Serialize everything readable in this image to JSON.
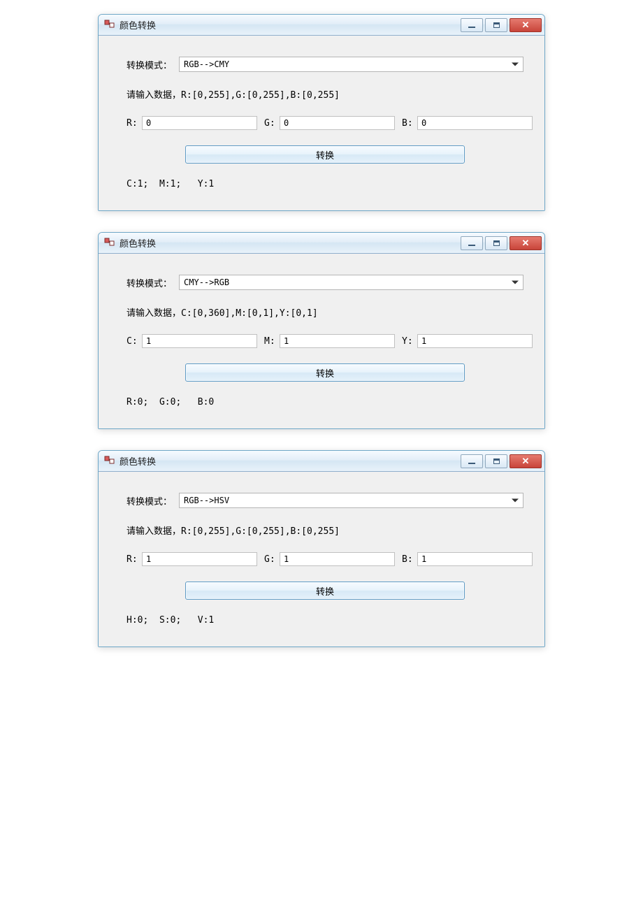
{
  "windows": [
    {
      "title": "颜色转换",
      "mode_label": "转换模式：",
      "mode_value": "RGB-->CMY",
      "hint": "请输入数据，R:[0,255],G:[0,255],B:[0,255]",
      "inputs": [
        {
          "label": "R:",
          "value": "0"
        },
        {
          "label": "G:",
          "value": "0"
        },
        {
          "label": "B:",
          "value": "0"
        }
      ],
      "convert_label": "转换",
      "result": "C:1;  M:1;   Y:1"
    },
    {
      "title": "颜色转换",
      "mode_label": "转换模式：",
      "mode_value": "CMY-->RGB",
      "hint": "请输入数据，C:[0,360],M:[0,1],Y:[0,1]",
      "inputs": [
        {
          "label": "C:",
          "value": "1"
        },
        {
          "label": "M:",
          "value": "1"
        },
        {
          "label": "Y:",
          "value": "1"
        }
      ],
      "convert_label": "转换",
      "result": "R:0;  G:0;   B:0"
    },
    {
      "title": "颜色转换",
      "mode_label": "转换模式：",
      "mode_value": "RGB-->HSV",
      "hint": "请输入数据，R:[0,255],G:[0,255],B:[0,255]",
      "inputs": [
        {
          "label": "R:",
          "value": "1"
        },
        {
          "label": "G:",
          "value": "1"
        },
        {
          "label": "B:",
          "value": "1"
        }
      ],
      "convert_label": "转换",
      "result": "H:0;  S:0;   V:1"
    }
  ]
}
